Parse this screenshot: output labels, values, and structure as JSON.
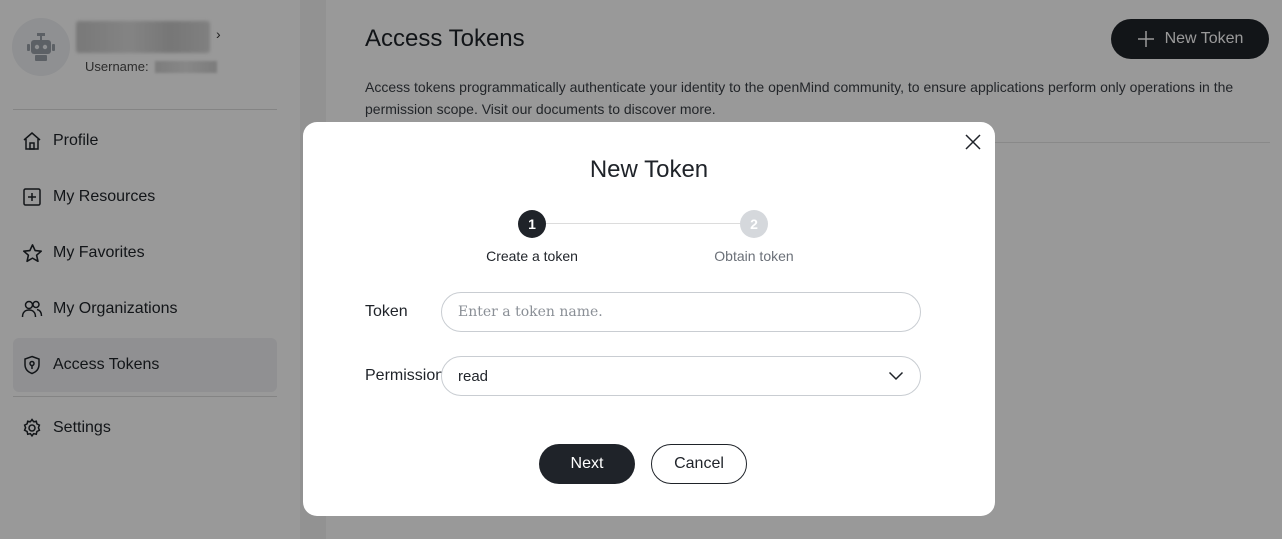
{
  "user": {
    "username_label": "Username:",
    "chevron": "›"
  },
  "sidebar": {
    "items": [
      {
        "label": "Profile",
        "icon": "home-icon"
      },
      {
        "label": "My Resources",
        "icon": "plus-square-icon"
      },
      {
        "label": "My Favorites",
        "icon": "star-icon"
      },
      {
        "label": "My Organizations",
        "icon": "users-icon"
      },
      {
        "label": "Access Tokens",
        "icon": "shield-key-icon",
        "active": true
      },
      {
        "label": "Settings",
        "icon": "gear-icon"
      }
    ]
  },
  "main": {
    "title": "Access Tokens",
    "new_token_label": "New Token",
    "description": "Access tokens programmatically authenticate your identity to the openMind community, to ensure applications perform only operations in the permission scope. Visit our documents to discover more."
  },
  "modal": {
    "title": "New Token",
    "steps": [
      {
        "number": "1",
        "label": "Create a token"
      },
      {
        "number": "2",
        "label": "Obtain token"
      }
    ],
    "token_label": "Token",
    "token_placeholder": "Enter a token name.",
    "token_value": "",
    "permission_label": "Permission",
    "permission_value": "read",
    "next_label": "Next",
    "cancel_label": "Cancel"
  },
  "colors": {
    "primary": "#1f2329",
    "overlay": "rgba(0,0,0,0.40)",
    "step_inactive": "#d5d8dc"
  }
}
